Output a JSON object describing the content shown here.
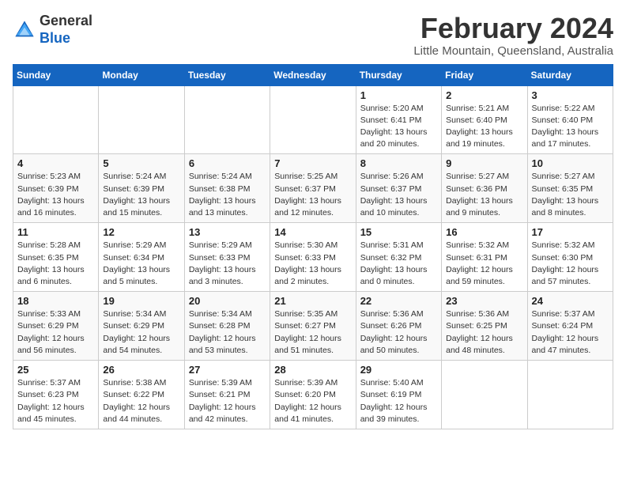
{
  "header": {
    "logo_general": "General",
    "logo_blue": "Blue",
    "month_title": "February 2024",
    "subtitle": "Little Mountain, Queensland, Australia"
  },
  "weekdays": [
    "Sunday",
    "Monday",
    "Tuesday",
    "Wednesday",
    "Thursday",
    "Friday",
    "Saturday"
  ],
  "weeks": [
    [
      {
        "day": "",
        "info": ""
      },
      {
        "day": "",
        "info": ""
      },
      {
        "day": "",
        "info": ""
      },
      {
        "day": "",
        "info": ""
      },
      {
        "day": "1",
        "info": "Sunrise: 5:20 AM\nSunset: 6:41 PM\nDaylight: 13 hours\nand 20 minutes."
      },
      {
        "day": "2",
        "info": "Sunrise: 5:21 AM\nSunset: 6:40 PM\nDaylight: 13 hours\nand 19 minutes."
      },
      {
        "day": "3",
        "info": "Sunrise: 5:22 AM\nSunset: 6:40 PM\nDaylight: 13 hours\nand 17 minutes."
      }
    ],
    [
      {
        "day": "4",
        "info": "Sunrise: 5:23 AM\nSunset: 6:39 PM\nDaylight: 13 hours\nand 16 minutes."
      },
      {
        "day": "5",
        "info": "Sunrise: 5:24 AM\nSunset: 6:39 PM\nDaylight: 13 hours\nand 15 minutes."
      },
      {
        "day": "6",
        "info": "Sunrise: 5:24 AM\nSunset: 6:38 PM\nDaylight: 13 hours\nand 13 minutes."
      },
      {
        "day": "7",
        "info": "Sunrise: 5:25 AM\nSunset: 6:37 PM\nDaylight: 13 hours\nand 12 minutes."
      },
      {
        "day": "8",
        "info": "Sunrise: 5:26 AM\nSunset: 6:37 PM\nDaylight: 13 hours\nand 10 minutes."
      },
      {
        "day": "9",
        "info": "Sunrise: 5:27 AM\nSunset: 6:36 PM\nDaylight: 13 hours\nand 9 minutes."
      },
      {
        "day": "10",
        "info": "Sunrise: 5:27 AM\nSunset: 6:35 PM\nDaylight: 13 hours\nand 8 minutes."
      }
    ],
    [
      {
        "day": "11",
        "info": "Sunrise: 5:28 AM\nSunset: 6:35 PM\nDaylight: 13 hours\nand 6 minutes."
      },
      {
        "day": "12",
        "info": "Sunrise: 5:29 AM\nSunset: 6:34 PM\nDaylight: 13 hours\nand 5 minutes."
      },
      {
        "day": "13",
        "info": "Sunrise: 5:29 AM\nSunset: 6:33 PM\nDaylight: 13 hours\nand 3 minutes."
      },
      {
        "day": "14",
        "info": "Sunrise: 5:30 AM\nSunset: 6:33 PM\nDaylight: 13 hours\nand 2 minutes."
      },
      {
        "day": "15",
        "info": "Sunrise: 5:31 AM\nSunset: 6:32 PM\nDaylight: 13 hours\nand 0 minutes."
      },
      {
        "day": "16",
        "info": "Sunrise: 5:32 AM\nSunset: 6:31 PM\nDaylight: 12 hours\nand 59 minutes."
      },
      {
        "day": "17",
        "info": "Sunrise: 5:32 AM\nSunset: 6:30 PM\nDaylight: 12 hours\nand 57 minutes."
      }
    ],
    [
      {
        "day": "18",
        "info": "Sunrise: 5:33 AM\nSunset: 6:29 PM\nDaylight: 12 hours\nand 56 minutes."
      },
      {
        "day": "19",
        "info": "Sunrise: 5:34 AM\nSunset: 6:29 PM\nDaylight: 12 hours\nand 54 minutes."
      },
      {
        "day": "20",
        "info": "Sunrise: 5:34 AM\nSunset: 6:28 PM\nDaylight: 12 hours\nand 53 minutes."
      },
      {
        "day": "21",
        "info": "Sunrise: 5:35 AM\nSunset: 6:27 PM\nDaylight: 12 hours\nand 51 minutes."
      },
      {
        "day": "22",
        "info": "Sunrise: 5:36 AM\nSunset: 6:26 PM\nDaylight: 12 hours\nand 50 minutes."
      },
      {
        "day": "23",
        "info": "Sunrise: 5:36 AM\nSunset: 6:25 PM\nDaylight: 12 hours\nand 48 minutes."
      },
      {
        "day": "24",
        "info": "Sunrise: 5:37 AM\nSunset: 6:24 PM\nDaylight: 12 hours\nand 47 minutes."
      }
    ],
    [
      {
        "day": "25",
        "info": "Sunrise: 5:37 AM\nSunset: 6:23 PM\nDaylight: 12 hours\nand 45 minutes."
      },
      {
        "day": "26",
        "info": "Sunrise: 5:38 AM\nSunset: 6:22 PM\nDaylight: 12 hours\nand 44 minutes."
      },
      {
        "day": "27",
        "info": "Sunrise: 5:39 AM\nSunset: 6:21 PM\nDaylight: 12 hours\nand 42 minutes."
      },
      {
        "day": "28",
        "info": "Sunrise: 5:39 AM\nSunset: 6:20 PM\nDaylight: 12 hours\nand 41 minutes."
      },
      {
        "day": "29",
        "info": "Sunrise: 5:40 AM\nSunset: 6:19 PM\nDaylight: 12 hours\nand 39 minutes."
      },
      {
        "day": "",
        "info": ""
      },
      {
        "day": "",
        "info": ""
      }
    ]
  ]
}
